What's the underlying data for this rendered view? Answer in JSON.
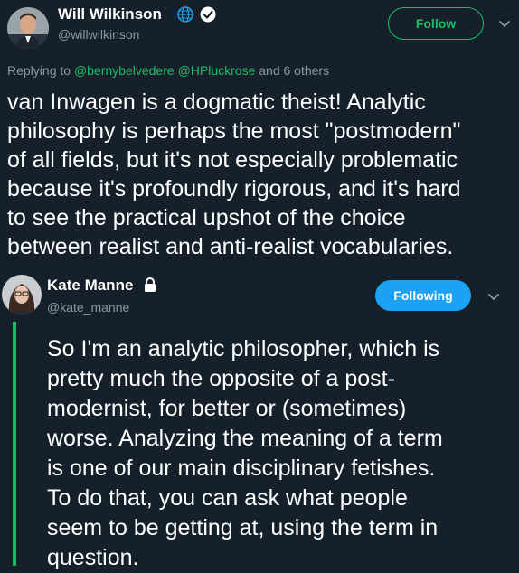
{
  "tweet1": {
    "name": "Will Wilkinson",
    "handle": "@willwilkinson",
    "follow_label": "Follow",
    "replying_prefix": "Replying to ",
    "mention1": "@bernybelvedere",
    "mention2": "@HPluckrose",
    "replying_suffix": " and 6 others",
    "text": "van Inwagen is a dogmatic theist! Analytic\nphilosophy is perhaps the most \"postmodern\"\nof all fields, but it's not especially problematic\nbecause it's profoundly rigorous, and it's hard\nto see the practical upshot of the choice\nbetween realist and anti-realist vocabularies."
  },
  "tweet2": {
    "name": "Kate Manne",
    "handle": "@kate_manne",
    "following_label": "Following",
    "text": "So I'm an analytic philosopher, which is\npretty much the opposite of a post-\nmodernist, for better or (sometimes)\nworse. Analyzing the meaning of a term\nis one of our main disciplinary fetishes.\nTo do that, you can ask what people\nseem to be getting at, using the term in\nquestion."
  },
  "colors": {
    "background": "#15202b",
    "accent_green": "#17bf63",
    "accent_blue": "#1da1f2",
    "muted": "#8899a6"
  },
  "icons": [
    "globe-icon",
    "verified-badge-icon",
    "lock-icon",
    "chevron-down-icon"
  ]
}
